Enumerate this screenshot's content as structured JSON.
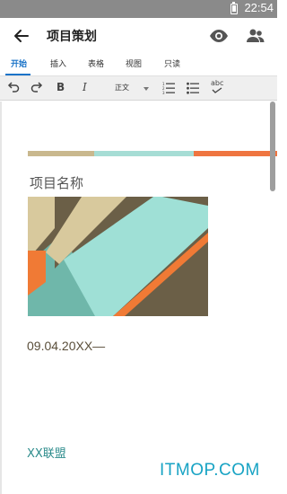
{
  "status_bar": {
    "time": "22:54"
  },
  "app_bar": {
    "title": "项目策划"
  },
  "tabs": [
    {
      "label": "开始",
      "active": true
    },
    {
      "label": "插入",
      "active": false
    },
    {
      "label": "表格",
      "active": false
    },
    {
      "label": "视图",
      "active": false
    },
    {
      "label": "只读",
      "active": false
    }
  ],
  "toolbar": {
    "bold_label": "B",
    "italic_label": "I",
    "style_value": "正文",
    "spell_label": "abc",
    "icons": [
      "undo-icon",
      "redo-icon",
      "bold-icon",
      "italic-icon",
      "paragraph-style-select",
      "numbered-list-icon",
      "bullet-list-icon",
      "spellcheck-icon"
    ]
  },
  "document": {
    "title": "项目名称",
    "date": "09.04.20XX—",
    "organization": "XX联盟",
    "colors": {
      "stripe_tan": "#c9b88e",
      "stripe_teal": "#a6ddd5",
      "stripe_orange": "#ef7540",
      "cover_teal": "#9fe0d6",
      "cover_dark": "#6b5f47",
      "cover_tan": "#d8c99d",
      "cover_orange": "#f07a35",
      "cover_mid_teal": "#6fb7aa"
    }
  },
  "watermark": {
    "text": "ITMOP.COM"
  }
}
